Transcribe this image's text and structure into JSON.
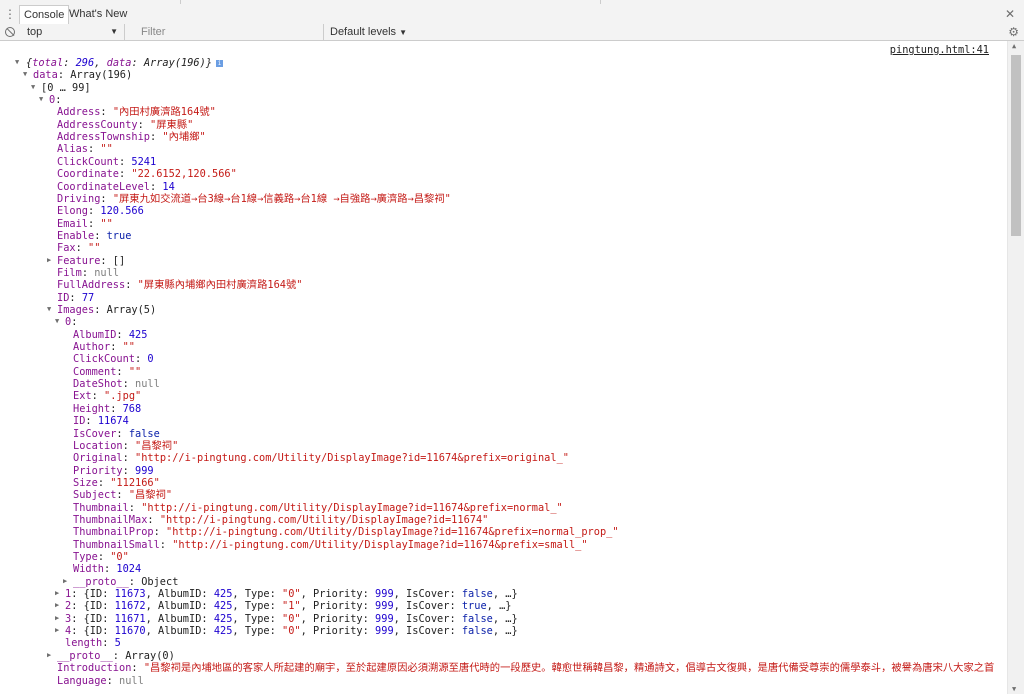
{
  "devtools": {
    "tabs": [
      {
        "label": "Console",
        "active": true
      },
      {
        "label": "What's New",
        "active": false
      }
    ],
    "toolbar": {
      "context": "top",
      "filter_placeholder": "Filter",
      "levels": "Default levels"
    }
  },
  "console": {
    "source_link": "pingtung.html:41",
    "lines": [
      {
        "indent": 0,
        "tri": "down",
        "parts": [
          [
            "o it",
            "{"
          ],
          [
            "k it",
            "total"
          ],
          [
            "o it",
            ": "
          ],
          [
            "n it",
            "296"
          ],
          [
            "o it",
            ", "
          ],
          [
            "k it",
            "data"
          ],
          [
            "o it",
            ": Array(196)}"
          ]
        ],
        "info": true
      },
      {
        "indent": 1,
        "tri": "down",
        "parts": [
          [
            "k",
            "data"
          ],
          [
            "o",
            ": Array(196)"
          ]
        ]
      },
      {
        "indent": 2,
        "tri": "down",
        "parts": [
          [
            "o",
            "[0 … 99]"
          ]
        ]
      },
      {
        "indent": 3,
        "tri": "down",
        "parts": [
          [
            "k",
            "0"
          ],
          [
            "o",
            ":"
          ]
        ]
      },
      {
        "indent": 4,
        "parts": [
          [
            "k",
            "Address"
          ],
          [
            "o",
            ": "
          ],
          [
            "s",
            "\"內田村廣濟路164號\""
          ]
        ]
      },
      {
        "indent": 4,
        "parts": [
          [
            "k",
            "AddressCounty"
          ],
          [
            "o",
            ": "
          ],
          [
            "s",
            "\"屏東縣\""
          ]
        ]
      },
      {
        "indent": 4,
        "parts": [
          [
            "k",
            "AddressTownship"
          ],
          [
            "o",
            ": "
          ],
          [
            "s",
            "\"內埔鄉\""
          ]
        ]
      },
      {
        "indent": 4,
        "parts": [
          [
            "k",
            "Alias"
          ],
          [
            "o",
            ": "
          ],
          [
            "s",
            "\"\""
          ]
        ]
      },
      {
        "indent": 4,
        "parts": [
          [
            "k",
            "ClickCount"
          ],
          [
            "o",
            ": "
          ],
          [
            "n",
            "5241"
          ]
        ]
      },
      {
        "indent": 4,
        "parts": [
          [
            "k",
            "Coordinate"
          ],
          [
            "o",
            ": "
          ],
          [
            "s",
            "\"22.6152,120.566\""
          ]
        ]
      },
      {
        "indent": 4,
        "parts": [
          [
            "k",
            "CoordinateLevel"
          ],
          [
            "o",
            ": "
          ],
          [
            "n",
            "14"
          ]
        ]
      },
      {
        "indent": 4,
        "parts": [
          [
            "k",
            "Driving"
          ],
          [
            "o",
            ": "
          ],
          [
            "s",
            "\"屏東九如交流道→台3線→台1線→信義路→台1線 →自強路→廣濟路→昌黎祠\""
          ]
        ]
      },
      {
        "indent": 4,
        "parts": [
          [
            "k",
            "Elong"
          ],
          [
            "o",
            ": "
          ],
          [
            "n",
            "120.566"
          ]
        ]
      },
      {
        "indent": 4,
        "parts": [
          [
            "k",
            "Email"
          ],
          [
            "o",
            ": "
          ],
          [
            "s",
            "\"\""
          ]
        ]
      },
      {
        "indent": 4,
        "parts": [
          [
            "k",
            "Enable"
          ],
          [
            "o",
            ": "
          ],
          [
            "b",
            "true"
          ]
        ]
      },
      {
        "indent": 4,
        "parts": [
          [
            "k",
            "Fax"
          ],
          [
            "o",
            ": "
          ],
          [
            "s",
            "\"\""
          ]
        ]
      },
      {
        "indent": 4,
        "tri": "right",
        "parts": [
          [
            "k",
            "Feature"
          ],
          [
            "o",
            ": []"
          ]
        ]
      },
      {
        "indent": 4,
        "parts": [
          [
            "k",
            "Film"
          ],
          [
            "o",
            ": "
          ],
          [
            "nl",
            "null"
          ]
        ]
      },
      {
        "indent": 4,
        "parts": [
          [
            "k",
            "FullAddress"
          ],
          [
            "o",
            ": "
          ],
          [
            "s",
            "\"屏東縣內埔鄉內田村廣濟路164號\""
          ]
        ]
      },
      {
        "indent": 4,
        "parts": [
          [
            "k",
            "ID"
          ],
          [
            "o",
            ": "
          ],
          [
            "n",
            "77"
          ]
        ]
      },
      {
        "indent": 4,
        "tri": "down",
        "parts": [
          [
            "k",
            "Images"
          ],
          [
            "o",
            ": Array(5)"
          ]
        ]
      },
      {
        "indent": 5,
        "tri": "down",
        "parts": [
          [
            "k",
            "0"
          ],
          [
            "o",
            ":"
          ]
        ]
      },
      {
        "indent": 6,
        "parts": [
          [
            "k",
            "AlbumID"
          ],
          [
            "o",
            ": "
          ],
          [
            "n",
            "425"
          ]
        ]
      },
      {
        "indent": 6,
        "parts": [
          [
            "k",
            "Author"
          ],
          [
            "o",
            ": "
          ],
          [
            "s",
            "\"\""
          ]
        ]
      },
      {
        "indent": 6,
        "parts": [
          [
            "k",
            "ClickCount"
          ],
          [
            "o",
            ": "
          ],
          [
            "n",
            "0"
          ]
        ]
      },
      {
        "indent": 6,
        "parts": [
          [
            "k",
            "Comment"
          ],
          [
            "o",
            ": "
          ],
          [
            "s",
            "\"\""
          ]
        ]
      },
      {
        "indent": 6,
        "parts": [
          [
            "k",
            "DateShot"
          ],
          [
            "o",
            ": "
          ],
          [
            "nl",
            "null"
          ]
        ]
      },
      {
        "indent": 6,
        "parts": [
          [
            "k",
            "Ext"
          ],
          [
            "o",
            ": "
          ],
          [
            "s",
            "\".jpg\""
          ]
        ]
      },
      {
        "indent": 6,
        "parts": [
          [
            "k",
            "Height"
          ],
          [
            "o",
            ": "
          ],
          [
            "n",
            "768"
          ]
        ]
      },
      {
        "indent": 6,
        "parts": [
          [
            "k",
            "ID"
          ],
          [
            "o",
            ": "
          ],
          [
            "n",
            "11674"
          ]
        ]
      },
      {
        "indent": 6,
        "parts": [
          [
            "k",
            "IsCover"
          ],
          [
            "o",
            ": "
          ],
          [
            "b",
            "false"
          ]
        ]
      },
      {
        "indent": 6,
        "parts": [
          [
            "k",
            "Location"
          ],
          [
            "o",
            ": "
          ],
          [
            "s",
            "\"昌黎祠\""
          ]
        ]
      },
      {
        "indent": 6,
        "parts": [
          [
            "k",
            "Original"
          ],
          [
            "o",
            ": "
          ],
          [
            "s",
            "\"http://i-pingtung.com/Utility/DisplayImage?id=11674&prefix=original_\""
          ]
        ]
      },
      {
        "indent": 6,
        "parts": [
          [
            "k",
            "Priority"
          ],
          [
            "o",
            ": "
          ],
          [
            "n",
            "999"
          ]
        ]
      },
      {
        "indent": 6,
        "parts": [
          [
            "k",
            "Size"
          ],
          [
            "o",
            ": "
          ],
          [
            "s",
            "\"112166\""
          ]
        ]
      },
      {
        "indent": 6,
        "parts": [
          [
            "k",
            "Subject"
          ],
          [
            "o",
            ": "
          ],
          [
            "s",
            "\"昌黎祠\""
          ]
        ]
      },
      {
        "indent": 6,
        "parts": [
          [
            "k",
            "Thumbnail"
          ],
          [
            "o",
            ": "
          ],
          [
            "s",
            "\"http://i-pingtung.com/Utility/DisplayImage?id=11674&prefix=normal_\""
          ]
        ]
      },
      {
        "indent": 6,
        "parts": [
          [
            "k",
            "ThumbnailMax"
          ],
          [
            "o",
            ": "
          ],
          [
            "s",
            "\"http://i-pingtung.com/Utility/DisplayImage?id=11674\""
          ]
        ]
      },
      {
        "indent": 6,
        "parts": [
          [
            "k",
            "ThumbnailProp"
          ],
          [
            "o",
            ": "
          ],
          [
            "s",
            "\"http://i-pingtung.com/Utility/DisplayImage?id=11674&prefix=normal_prop_\""
          ]
        ]
      },
      {
        "indent": 6,
        "parts": [
          [
            "k",
            "ThumbnailSmall"
          ],
          [
            "o",
            ": "
          ],
          [
            "s",
            "\"http://i-pingtung.com/Utility/DisplayImage?id=11674&prefix=small_\""
          ]
        ]
      },
      {
        "indent": 6,
        "parts": [
          [
            "k",
            "Type"
          ],
          [
            "o",
            ": "
          ],
          [
            "s",
            "\"0\""
          ]
        ]
      },
      {
        "indent": 6,
        "parts": [
          [
            "k",
            "Width"
          ],
          [
            "o",
            ": "
          ],
          [
            "n",
            "1024"
          ]
        ]
      },
      {
        "indent": 6,
        "tri": "right",
        "parts": [
          [
            "k",
            "__proto__"
          ],
          [
            "o",
            ": Object"
          ]
        ]
      },
      {
        "indent": 5,
        "tri": "right",
        "parts": [
          [
            "k",
            "1"
          ],
          [
            "o",
            ": {ID: "
          ],
          [
            "n",
            "11673"
          ],
          [
            "o",
            ", AlbumID: "
          ],
          [
            "n",
            "425"
          ],
          [
            "o",
            ", Type: "
          ],
          [
            "s",
            "\"0\""
          ],
          [
            "o",
            ", Priority: "
          ],
          [
            "n",
            "999"
          ],
          [
            "o",
            ", IsCover: "
          ],
          [
            "b",
            "false"
          ],
          [
            "o",
            ", …}"
          ]
        ]
      },
      {
        "indent": 5,
        "tri": "right",
        "parts": [
          [
            "k",
            "2"
          ],
          [
            "o",
            ": {ID: "
          ],
          [
            "n",
            "11672"
          ],
          [
            "o",
            ", AlbumID: "
          ],
          [
            "n",
            "425"
          ],
          [
            "o",
            ", Type: "
          ],
          [
            "s",
            "\"1\""
          ],
          [
            "o",
            ", Priority: "
          ],
          [
            "n",
            "999"
          ],
          [
            "o",
            ", IsCover: "
          ],
          [
            "b",
            "true"
          ],
          [
            "o",
            ", …}"
          ]
        ]
      },
      {
        "indent": 5,
        "tri": "right",
        "parts": [
          [
            "k",
            "3"
          ],
          [
            "o",
            ": {ID: "
          ],
          [
            "n",
            "11671"
          ],
          [
            "o",
            ", AlbumID: "
          ],
          [
            "n",
            "425"
          ],
          [
            "o",
            ", Type: "
          ],
          [
            "s",
            "\"0\""
          ],
          [
            "o",
            ", Priority: "
          ],
          [
            "n",
            "999"
          ],
          [
            "o",
            ", IsCover: "
          ],
          [
            "b",
            "false"
          ],
          [
            "o",
            ", …}"
          ]
        ]
      },
      {
        "indent": 5,
        "tri": "right",
        "parts": [
          [
            "k",
            "4"
          ],
          [
            "o",
            ": {ID: "
          ],
          [
            "n",
            "11670"
          ],
          [
            "o",
            ", AlbumID: "
          ],
          [
            "n",
            "425"
          ],
          [
            "o",
            ", Type: "
          ],
          [
            "s",
            "\"0\""
          ],
          [
            "o",
            ", Priority: "
          ],
          [
            "n",
            "999"
          ],
          [
            "o",
            ", IsCover: "
          ],
          [
            "b",
            "false"
          ],
          [
            "o",
            ", …}"
          ]
        ]
      },
      {
        "indent": 5,
        "parts": [
          [
            "k",
            "length"
          ],
          [
            "o",
            ": "
          ],
          [
            "n",
            "5"
          ]
        ]
      },
      {
        "indent": 4,
        "tri": "right",
        "parts": [
          [
            "k",
            "__proto__"
          ],
          [
            "o",
            ": Array(0)"
          ]
        ]
      },
      {
        "indent": 4,
        "parts": [
          [
            "k",
            "Introduction"
          ],
          [
            "o",
            ": "
          ],
          [
            "s",
            "\"昌黎祠是內埔地區的客家人所起建的廟宇，至於起建原因必須溯源至唐代時的一段歷史。韓愈世稱韓昌黎，精通詩文，倡導古文復興，是唐代備受尊崇的儒學泰斗，被譽為唐宋八大家之首"
          ]
        ]
      },
      {
        "indent": 4,
        "parts": [
          [
            "k",
            "Language"
          ],
          [
            "o",
            ": "
          ],
          [
            "nl",
            "null"
          ]
        ]
      }
    ]
  }
}
